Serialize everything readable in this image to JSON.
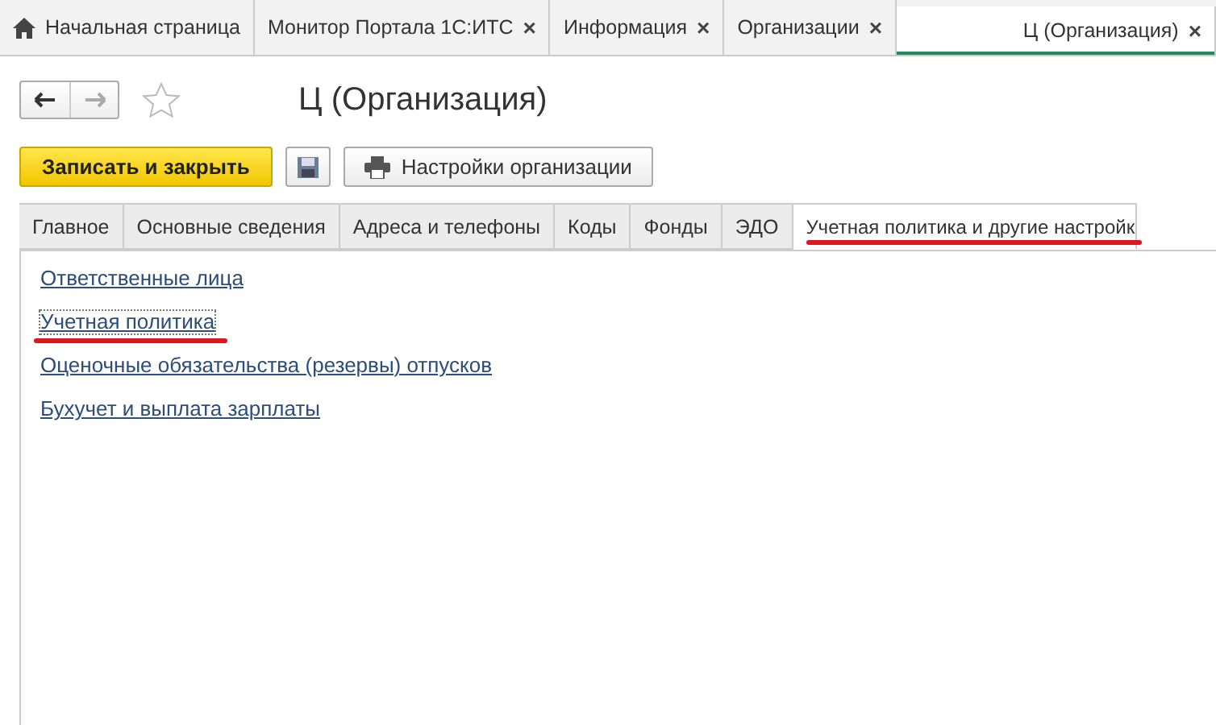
{
  "window_tabs": [
    {
      "kind": "home",
      "label": "Начальная страница",
      "selected": false
    },
    {
      "kind": "page",
      "label": "Монитор Портала 1С:ИТС",
      "selected": false
    },
    {
      "kind": "page",
      "label": "Информация",
      "selected": false
    },
    {
      "kind": "page",
      "label": "Организации",
      "selected": false
    },
    {
      "kind": "page",
      "label": "Ц (Организация)",
      "selected": true
    }
  ],
  "close_glyph": "×",
  "title": "Ц (Организация)",
  "favorite": false,
  "toolbar": {
    "primary": "Записать и закрыть",
    "settings": "Настройки организации"
  },
  "form_tabs": [
    {
      "label": "Главное",
      "selected": false,
      "annotated": false
    },
    {
      "label": "Основные сведения",
      "selected": false,
      "annotated": false
    },
    {
      "label": "Адреса и телефоны",
      "selected": false,
      "annotated": false
    },
    {
      "label": "Коды",
      "selected": false,
      "annotated": false
    },
    {
      "label": "Фонды",
      "selected": false,
      "annotated": false
    },
    {
      "label": "ЭДО",
      "selected": false,
      "annotated": false
    },
    {
      "label": "Учетная политика и другие настройк",
      "selected": true,
      "annotated": true
    }
  ],
  "links": [
    {
      "label": "Ответственные лица",
      "focused": false,
      "annotated": false
    },
    {
      "label": "Учетная политика",
      "focused": true,
      "annotated": true
    },
    {
      "label": "Оценочные обязательства (резервы) отпусков",
      "focused": false,
      "annotated": false
    },
    {
      "label": "Бухучет и выплата зарплаты",
      "focused": false,
      "annotated": false
    }
  ]
}
